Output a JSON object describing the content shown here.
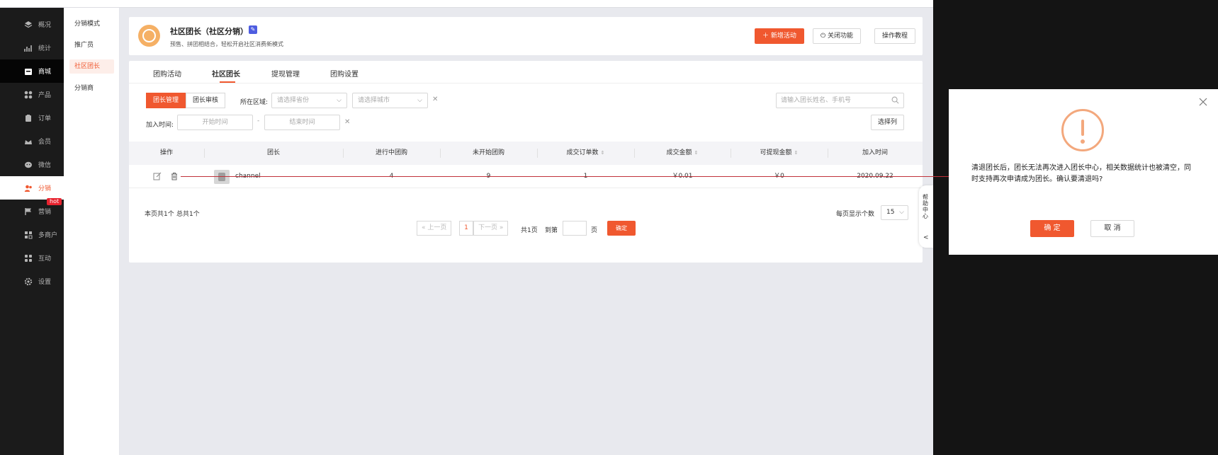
{
  "sidebar": {
    "items": [
      {
        "label": "概况",
        "icon": "layers-icon"
      },
      {
        "label": "统计",
        "icon": "chart-icon"
      },
      {
        "label": "商城",
        "icon": "shop-icon"
      },
      {
        "label": "产品",
        "icon": "grid-icon"
      },
      {
        "label": "订单",
        "icon": "clipboard-icon"
      },
      {
        "label": "会员",
        "icon": "member-icon"
      },
      {
        "label": "微信",
        "icon": "wechat-icon"
      },
      {
        "label": "分销",
        "icon": "users-icon"
      },
      {
        "label": "营销",
        "icon": "flag-icon"
      },
      {
        "label": "多商户",
        "icon": "store-icon"
      },
      {
        "label": "互动",
        "icon": "interact-icon"
      },
      {
        "label": "设置",
        "icon": "gear-icon"
      }
    ],
    "hot_badge": "hot"
  },
  "subnav": {
    "items": [
      "分销模式",
      "推广员",
      "社区团长",
      "分销商"
    ]
  },
  "header": {
    "title": "社区团长（社区分销）",
    "description": "预售、拼团相结合，轻松开启社区消费新模式",
    "add_activity": "新增活动",
    "close_feature": "关闭功能",
    "tutorial": "操作教程"
  },
  "tabs": [
    "团购活动",
    "社区团长",
    "提现管理",
    "团购设置"
  ],
  "filters": {
    "manage_btn": "团长管理",
    "review_btn": "团长审核",
    "region_label": "所在区域:",
    "province_placeholder": "请选择省份",
    "city_placeholder": "请选择城市",
    "search_placeholder": "请输入团长姓名、手机号",
    "join_time_label": "加入时间:",
    "start_placeholder": "开始时间",
    "end_placeholder": "结束时间",
    "dash": "-",
    "choose_columns": "选择列"
  },
  "table": {
    "headers": [
      "操作",
      "团长",
      "进行中团购",
      "未开始团购",
      "成交订单数",
      "成交金额",
      "可提现金额",
      "加入时间"
    ],
    "rows": [
      {
        "name": "channel",
        "ongoing": "4",
        "not_started": "9",
        "orders": "1",
        "amount": "￥0.01",
        "withdrawable": "￥0",
        "join_time": "2020.09.22"
      }
    ]
  },
  "pagination": {
    "page_summary": "本页共1个",
    "total_summary": "总共1个",
    "prev": "上一页",
    "current": "1",
    "next": "下一页",
    "total_pages": "共1页",
    "goto_label": "到第",
    "page_unit": "页",
    "goto_btn": "确定",
    "page_size_label": "每页显示个数",
    "page_size": "15"
  },
  "help": {
    "label": "帮助中心",
    "arrow": "<"
  },
  "dialog": {
    "message": "清退团长后，团长无法再次进入团长中心，相关数据统计也被清空，同时支持再次申请成为团长。确认要清退吗?",
    "confirm": "确 定",
    "cancel": "取 消"
  },
  "colors": {
    "accent": "#f0582f",
    "warning": "#f3a87d",
    "sidebar_bg": "#1b1b1b"
  }
}
